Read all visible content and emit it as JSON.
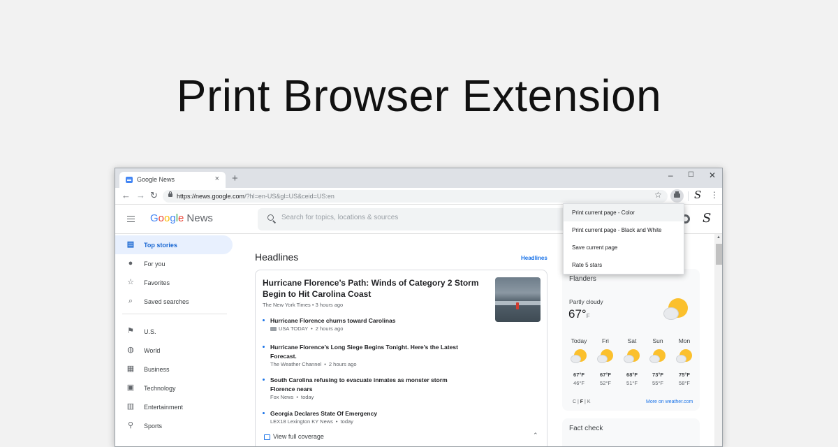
{
  "promo": {
    "title": "Print Browser Extension"
  },
  "browser": {
    "tab_title": "Google News",
    "tab_close": "×",
    "new_tab": "+",
    "window_controls": {
      "minimize": "–",
      "maximize": "☐",
      "close": "✕"
    },
    "nav": {
      "back": "←",
      "forward": "→",
      "reload": "↻"
    },
    "url_host": "https://news.google.com",
    "url_path": "/?hl=en-US&gl=US&ceid=US:en",
    "bookmark_star": "☆",
    "ext_s": "S",
    "menu": "⋮"
  },
  "gnews": {
    "logo_google": [
      {
        "ch": "G",
        "color": "#4285F4"
      },
      {
        "ch": "o",
        "color": "#EA4335"
      },
      {
        "ch": "o",
        "color": "#FBBC05"
      },
      {
        "ch": "g",
        "color": "#4285F4"
      },
      {
        "ch": "l",
        "color": "#34A853"
      },
      {
        "ch": "e",
        "color": "#EA4335"
      }
    ],
    "logo_news": "News",
    "search_placeholder": "Search for topics, locations & sources",
    "header_s": "S"
  },
  "sidebar": {
    "items": [
      {
        "label": "Top stories",
        "icon": "top-stories-icon",
        "glyph": "▤",
        "active": true
      },
      {
        "label": "For you",
        "icon": "person-icon",
        "glyph": "●"
      },
      {
        "label": "Favorites",
        "icon": "star-icon",
        "glyph": "☆"
      },
      {
        "label": "Saved searches",
        "icon": "search-icon",
        "glyph": "⌕"
      },
      {
        "label": "U.S.",
        "icon": "flag-icon",
        "glyph": "⚑"
      },
      {
        "label": "World",
        "icon": "globe-icon",
        "glyph": "◍"
      },
      {
        "label": "Business",
        "icon": "building-icon",
        "glyph": "▦"
      },
      {
        "label": "Technology",
        "icon": "chip-icon",
        "glyph": "▣"
      },
      {
        "label": "Entertainment",
        "icon": "film-icon",
        "glyph": "▥"
      },
      {
        "label": "Sports",
        "icon": "bike-icon",
        "glyph": "⚲"
      }
    ]
  },
  "main": {
    "section_title": "Headlines",
    "section_link": "Headlines",
    "lead": {
      "title": "Hurricane Florence’s Path: Winds of Category 2 Storm Begin to Hit Carolina Coast",
      "source": "The New York Times",
      "time": "3 hours ago"
    },
    "related": [
      {
        "title": "Hurricane Florence churns toward Carolinas",
        "source": "USA TODAY",
        "time": "2 hours ago",
        "video": true
      },
      {
        "title": "Hurricane Florence’s Long Siege Begins Tonight. Here’s the Latest Forecast.",
        "source": "The Weather Channel",
        "time": "2 hours ago"
      },
      {
        "title": "South Carolina refusing to evacuate inmates as monster storm Florence nears",
        "source": "Fox News",
        "time": "today"
      },
      {
        "title": "Georgia Declares State Of Emergency",
        "source": "LEX18 Lexington KY News",
        "time": "today"
      }
    ],
    "meta_sep": "•",
    "view_coverage": "View full coverage",
    "collapse": "⌃"
  },
  "weather": {
    "place": "Flanders",
    "condition": "Partly cloudy",
    "temp": "67°",
    "unit": "F",
    "days": [
      {
        "name": "Today",
        "hi": "67°F",
        "lo": "46°F"
      },
      {
        "name": "Fri",
        "hi": "67°F",
        "lo": "52°F"
      },
      {
        "name": "Sat",
        "hi": "68°F",
        "lo": "51°F"
      },
      {
        "name": "Sun",
        "hi": "73°F",
        "lo": "55°F"
      },
      {
        "name": "Mon",
        "hi": "75°F",
        "lo": "58°F"
      }
    ],
    "units_c": "C",
    "units_f": "F",
    "units_k": "K",
    "units_sep": "|",
    "more_link": "More on weather.com"
  },
  "factcheck": {
    "title": "Fact check"
  },
  "popup": {
    "items": [
      "Print current page - Color",
      "Print current page - Black and White",
      "Save current page",
      "Rate 5 stars"
    ]
  },
  "colors": {
    "accent": "#1a73e8",
    "active_bg": "#e8f0fe",
    "sun": "#fbc02d"
  }
}
